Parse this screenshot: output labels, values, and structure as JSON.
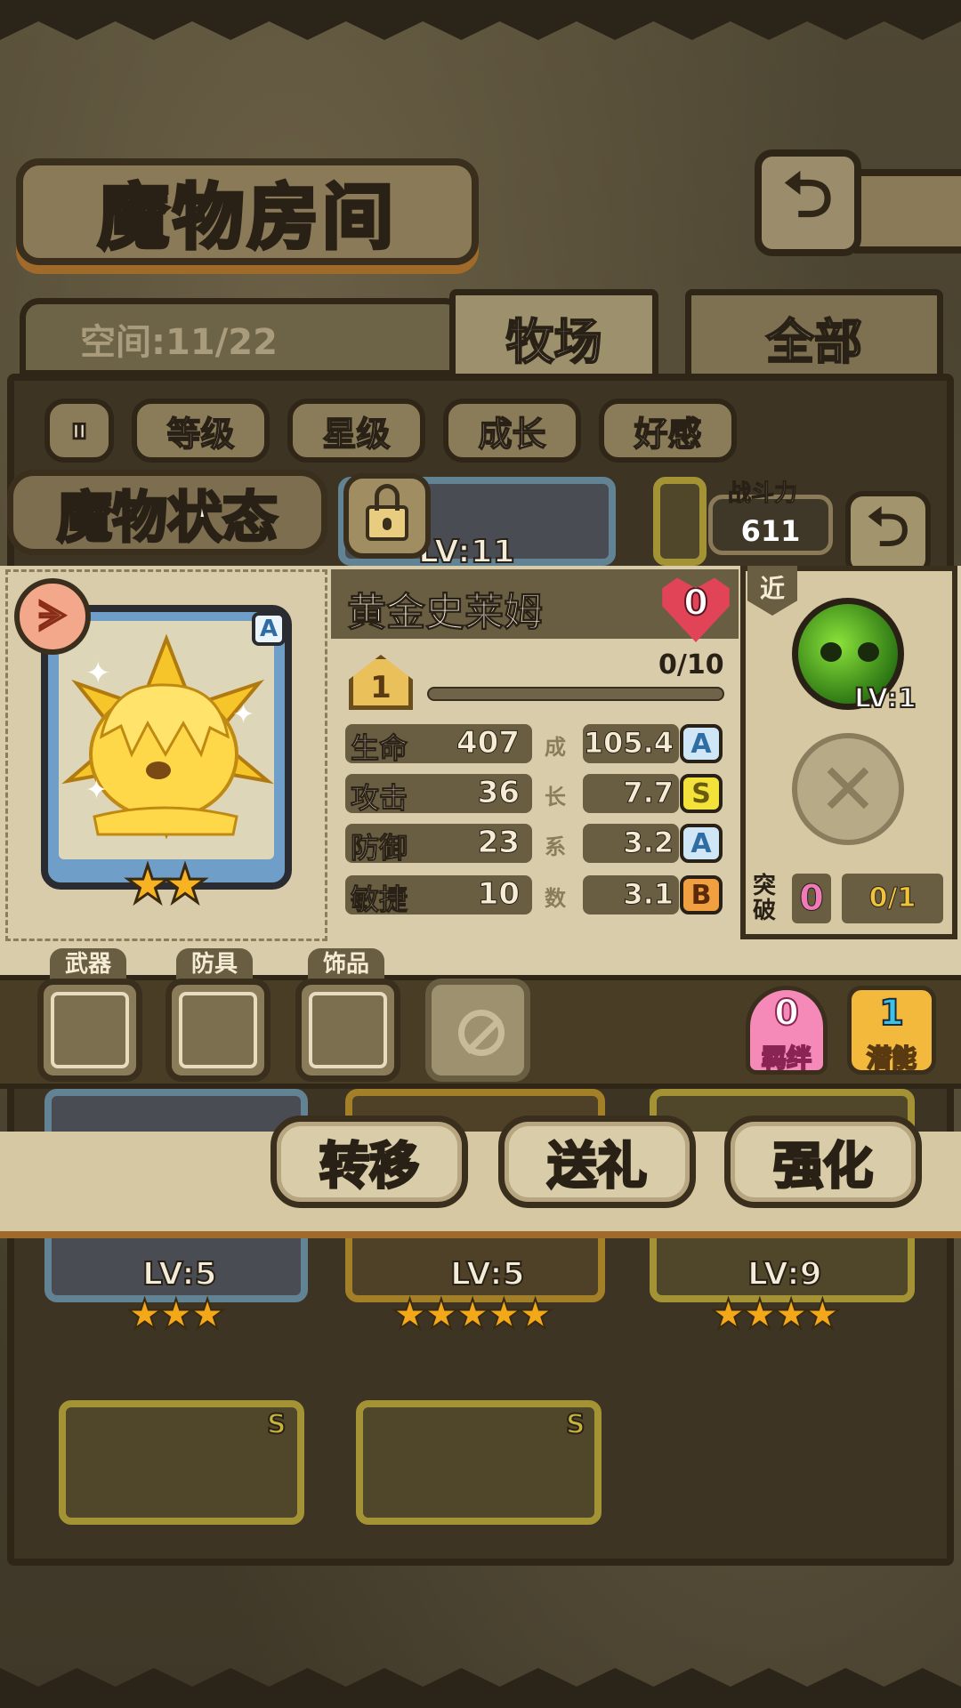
{
  "header": {
    "title": "魔物房间",
    "back_icon": "back-arrow-icon"
  },
  "storage": {
    "space_label": "空间:11/22"
  },
  "tabs": [
    {
      "label": "牧场",
      "active": true
    },
    {
      "label": "全部",
      "active": false
    }
  ],
  "filters": {
    "sort_icon": "sort-toggle-icon",
    "items": [
      "等级",
      "星级",
      "成长",
      "好感"
    ]
  },
  "background_cards": [
    {
      "lv": "LV:11",
      "stars": ""
    },
    {
      "lv": "LV:5",
      "stars": "★★★"
    },
    {
      "lv": "LV:5",
      "stars": "★★★★★"
    },
    {
      "lv": "LV:9",
      "stars": "★★★★"
    },
    {
      "rank": "S"
    },
    {
      "rank": "S"
    }
  ],
  "status": {
    "title": "魔物状态",
    "power_label": "战斗力",
    "power_value": "611",
    "monster": {
      "name": "黄金史莱姆",
      "rank": "A",
      "stars": "★★",
      "star_count": 2,
      "affection": "0",
      "level": "1",
      "exp_text": "0/10",
      "exp_fraction": 0.0
    },
    "stats": [
      {
        "label": "生命",
        "value": "407",
        "growth": "105.4",
        "grade": "A"
      },
      {
        "label": "攻击",
        "value": "36",
        "growth": "7.7",
        "grade": "S"
      },
      {
        "label": "防御",
        "value": "23",
        "growth": "3.2",
        "grade": "A"
      },
      {
        "label": "敏捷",
        "value": "10",
        "growth": "3.1",
        "grade": "B"
      }
    ],
    "growth_caption": [
      "成",
      "长",
      "系",
      "数"
    ],
    "skill": {
      "range_tag": "近",
      "level": "LV:1"
    },
    "breakthrough": {
      "label": "突破",
      "count": "0",
      "progress": "0/1"
    }
  },
  "equipment": {
    "slots": [
      "武器",
      "防具",
      "饰品"
    ]
  },
  "extras": {
    "bond_count": "0",
    "bond_label": "羁绊",
    "potential_count": "1",
    "potential_label": "潜能"
  },
  "actions": [
    "转移",
    "送礼",
    "强化"
  ],
  "colors": {
    "grade_S": "#f2e23a",
    "grade_A": "#cfe6f6",
    "grade_B": "#f0a040",
    "accent_gold": "#f3b93c",
    "heart": "#e04456"
  }
}
